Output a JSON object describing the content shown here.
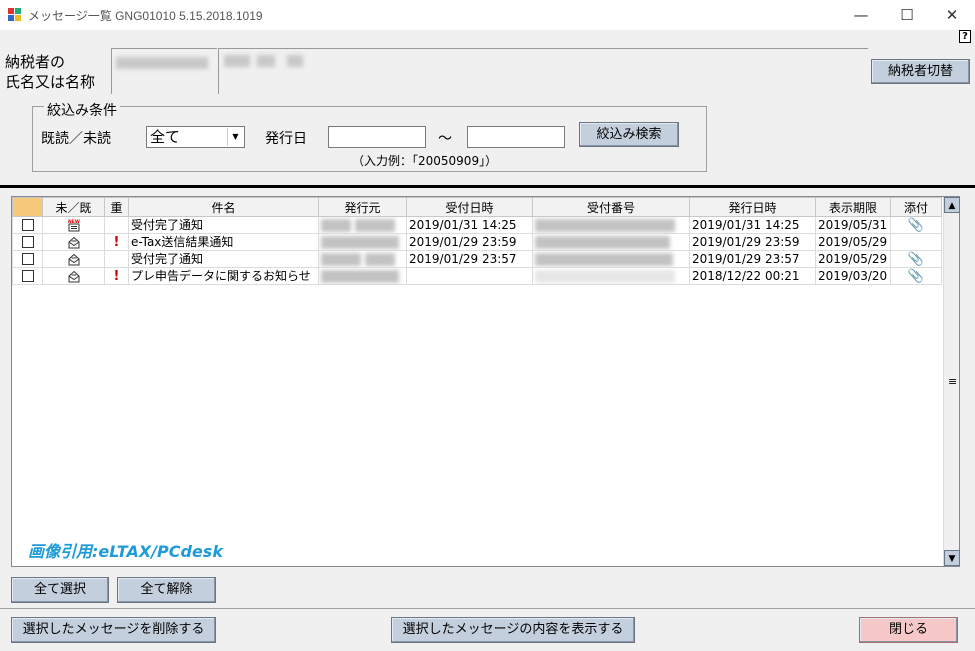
{
  "window": {
    "title": "メッセージ一覧 GNG01010  5.15.2018.1019",
    "minimize": "—",
    "maximize": "☐",
    "close": "✕",
    "help": "?"
  },
  "taxpayer": {
    "label_line1": "納税者の",
    "label_line2": "氏名又は名称",
    "switch_button": "納税者切替"
  },
  "filter": {
    "group_title": "絞込み条件",
    "read_label": "既読／未読",
    "read_value": "全て",
    "date_label": "発行日",
    "range_sep": "～",
    "search_button": "絞込み検索",
    "hint": "（入力例：「20050909」）"
  },
  "grid": {
    "headers": [
      "",
      "未／既",
      "重",
      "件名",
      "発行元",
      "受付日時",
      "受付番号",
      "発行日時",
      "表示期限",
      "添付"
    ],
    "rows": [
      {
        "status": "new",
        "important": false,
        "subject": "受付完了通知",
        "received": "2019/01/31 14:25",
        "issued": "2019/01/31 14:25",
        "expiry": "2019/05/31",
        "attachment": true
      },
      {
        "status": "read",
        "important": true,
        "subject": "e-Tax送信結果通知",
        "received": "2019/01/29 23:59",
        "issued": "2019/01/29 23:59",
        "expiry": "2019/05/29",
        "attachment": false
      },
      {
        "status": "read",
        "important": false,
        "subject": "受付完了通知",
        "received": "2019/01/29 23:57",
        "issued": "2019/01/29 23:57",
        "expiry": "2019/05/29",
        "attachment": true
      },
      {
        "status": "read",
        "important": true,
        "subject": "プレ申告データに関するお知らせ",
        "received": "",
        "issued": "2018/12/22 00:21",
        "expiry": "2019/03/20",
        "attachment": true
      }
    ],
    "important_mark": "!",
    "attachment_mark": "📎"
  },
  "watermark": "画像引用:eLTAX/PCdesk",
  "buttons": {
    "select_all": "全て選択",
    "clear_all": "全て解除",
    "delete_selected": "選択したメッセージを削除する",
    "show_selected": "選択したメッセージの内容を表示する",
    "close": "閉じる"
  },
  "colors": {
    "button_face": "#c4cfdd",
    "close_button": "#f6c8c8",
    "watermark": "#1f9bd8",
    "important": "#d00000"
  }
}
